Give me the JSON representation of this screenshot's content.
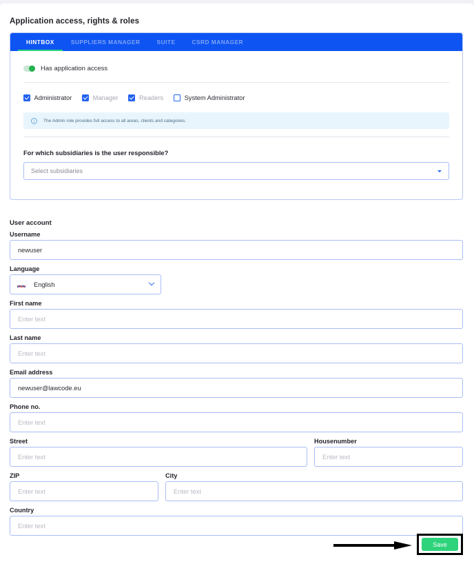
{
  "page": {
    "section_title": "Application access, rights & roles"
  },
  "access_card": {
    "tabs": [
      {
        "label": "HINTBOX",
        "active": true
      },
      {
        "label": "SUPPLIERS MANAGER",
        "active": false
      },
      {
        "label": "SUITE",
        "active": false
      },
      {
        "label": "CSRD MANAGER",
        "active": false
      }
    ],
    "toggle": {
      "label": "Has application access",
      "enabled": true
    },
    "roles": [
      {
        "label": "Administrator",
        "checked": true,
        "disabled": false
      },
      {
        "label": "Manager",
        "checked": true,
        "disabled": true
      },
      {
        "label": "Readers",
        "checked": true,
        "disabled": true
      },
      {
        "label": "System Administrator",
        "checked": false,
        "disabled": false
      }
    ],
    "info": {
      "icon": "info-circle-icon",
      "text": "The Admin role provides full access to all areas, clients and categories."
    },
    "subsidiaries": {
      "question": "For which subsidiaries is the user responsible?",
      "placeholder": "Select subsidiaries",
      "value": ""
    }
  },
  "user_account": {
    "heading": "User account",
    "username": {
      "label": "Username",
      "value": "newuser",
      "placeholder": "Enter text"
    },
    "language": {
      "label": "Language",
      "value": "English",
      "flag": "uk-flag-icon"
    },
    "first_name": {
      "label": "First name",
      "value": "",
      "placeholder": "Enter text"
    },
    "last_name": {
      "label": "Last name",
      "value": "",
      "placeholder": "Enter text"
    },
    "email": {
      "label": "Email address",
      "value": "newuser@lawcode.eu",
      "placeholder": "Enter text"
    },
    "phone": {
      "label": "Phone no.",
      "value": "",
      "placeholder": "Enter text"
    },
    "street": {
      "label": "Street",
      "value": "",
      "placeholder": "Enter text"
    },
    "housenumber": {
      "label": "Housenumber",
      "value": "",
      "placeholder": "Enter text"
    },
    "zip": {
      "label": "ZIP",
      "value": "",
      "placeholder": "Enter text"
    },
    "city": {
      "label": "City",
      "value": "",
      "placeholder": "Enter text"
    },
    "country": {
      "label": "Country",
      "value": "",
      "placeholder": "Enter text"
    }
  },
  "footer": {
    "save_label": "Save"
  },
  "colors": {
    "tab_bar": "#0d54f2",
    "tab_active_underline": "#2ad37f",
    "checkbox": "#2463f0",
    "input_border": "#a9bdf5",
    "info_bg": "#e8f5fd",
    "save_button": "#2ed37c",
    "toggle_on": "#23b14d"
  }
}
